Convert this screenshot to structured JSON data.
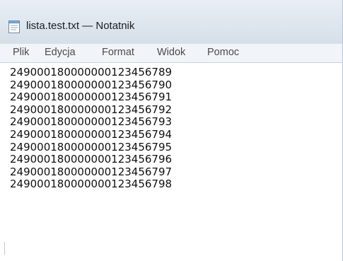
{
  "window": {
    "title": "lista.test.txt — Notatnik",
    "app_icon": "notepad-icon"
  },
  "menu": {
    "items": [
      {
        "label": "Plik"
      },
      {
        "label": "Edycja"
      },
      {
        "label": "Format"
      },
      {
        "label": "Widok"
      },
      {
        "label": "Pomoc"
      }
    ]
  },
  "document": {
    "lines": [
      "249000180000000123456789",
      "249000180000000123456790",
      "249000180000000123456791",
      "249000180000000123456792",
      "249000180000000123456793",
      "249000180000000123456794",
      "249000180000000123456795",
      "249000180000000123456796",
      "249000180000000123456797",
      "249000180000000123456798"
    ]
  },
  "colors": {
    "titlebar": "#dde5ee",
    "menubar": "#f1f4f8",
    "text": "#101010",
    "menu_text": "#4b4b4b"
  }
}
